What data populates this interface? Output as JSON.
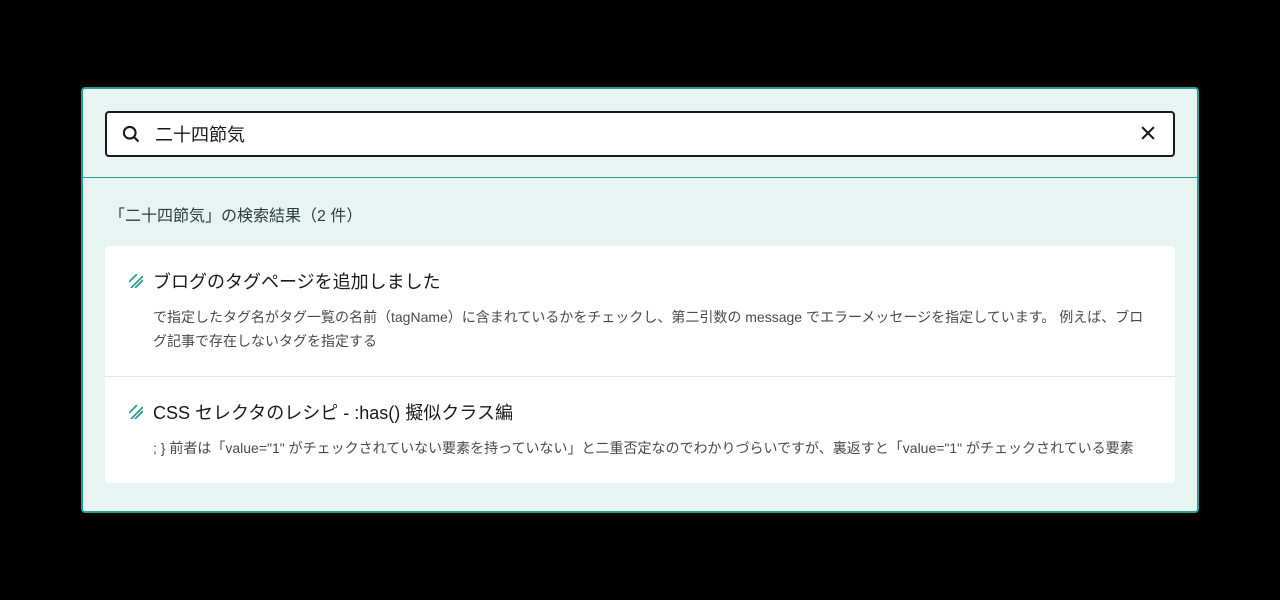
{
  "search": {
    "value": "二十四節気",
    "placeholder": ""
  },
  "results": {
    "heading": "「二十四節気」の検索結果（2 件）",
    "items": [
      {
        "title": "ブログのタグページを追加しました",
        "snippet": "で指定したタグ名がタグ一覧の名前（tagName）に含まれているかをチェックし、第二引数の message でエラーメッセージを指定しています。 例えば、ブログ記事で存在しないタグを指定する"
      },
      {
        "title": "CSS セレクタのレシピ - :has() 擬似クラス編",
        "snippet": "; } 前者は「value=\"1\" がチェックされていない要素を持っていない」と二重否定なのでわかりづらいですが、裏返すと「value=\"1\" がチェックされている要素"
      }
    ]
  },
  "colors": {
    "accent": "#2a9d8f",
    "panelBg": "#e8f4f2"
  }
}
